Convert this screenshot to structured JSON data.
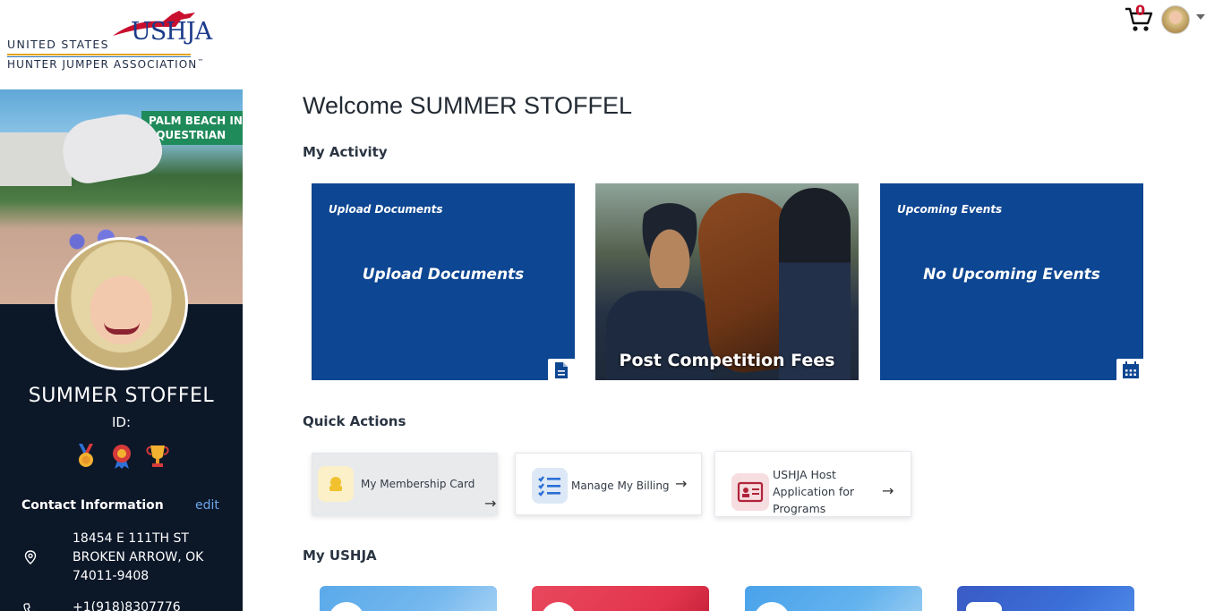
{
  "header": {
    "logo_line1": "UNITED STATES",
    "logo_mark": "USHJA",
    "logo_line2": "HUNTER JUMPER ASSOCIATION",
    "logo_tm": "™",
    "cart_count": "0"
  },
  "profile": {
    "name": "SUMMER STOFFEL",
    "id_label": "ID:",
    "hero_banner": "PALM BEACH IN\nEQUESTRIAN",
    "badges": [
      "medal-icon",
      "rosette-icon",
      "trophy-icon"
    ],
    "contact_title": "Contact Information",
    "edit_label": "edit",
    "address_line1": "18454 E 111TH ST",
    "address_line2": "BROKEN ARROW, OK",
    "address_line3": "74011-9408",
    "phone": "+1(918)8307776"
  },
  "main": {
    "welcome": "Welcome SUMMER STOFFEL",
    "activity_title": "My Activity",
    "tiles": [
      {
        "small": "Upload Documents",
        "big": "Upload Documents",
        "icon": "document-icon"
      },
      {
        "label": "Post Competition Fees"
      },
      {
        "small": "Upcoming Events",
        "big": "No Upcoming Events",
        "icon": "calendar-icon"
      }
    ],
    "quick_title": "Quick Actions",
    "quick_actions": [
      {
        "label": "My Membership Card",
        "icon": "membership-card-icon"
      },
      {
        "label": "Manage My Billing",
        "icon": "billing-list-icon"
      },
      {
        "label_l1": "USHJA Host",
        "label_l2": "Application for",
        "label_l3": "Programs",
        "icon": "id-card-icon"
      }
    ],
    "arrow": "→",
    "myushja_title": "My USHJA"
  },
  "colors": {
    "navy_tile": "#0d4692",
    "sidebar": "#0c1728",
    "accent_red": "#c8102e",
    "link_blue": "#6aa6e8"
  }
}
